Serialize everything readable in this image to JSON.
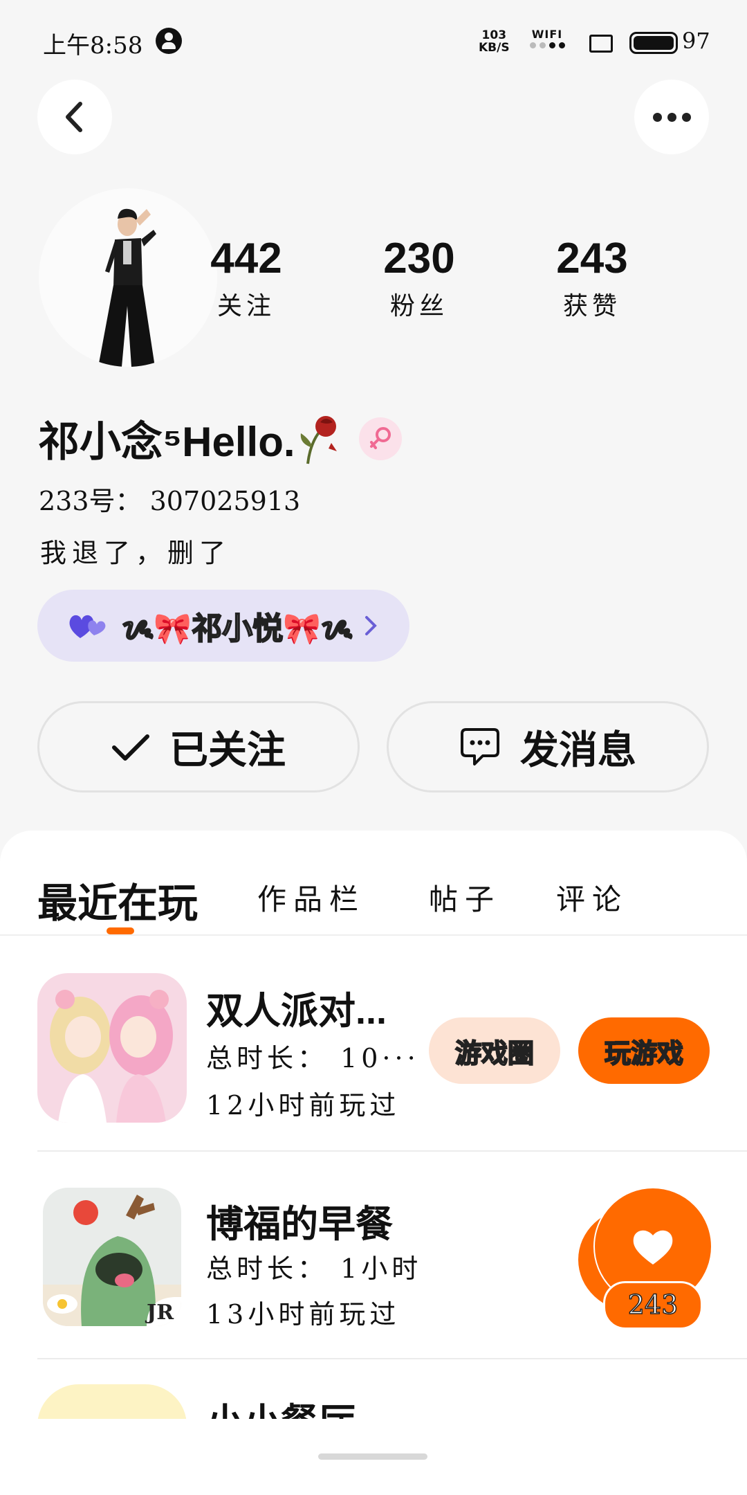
{
  "status_bar": {
    "time": "上午8:58",
    "speed_value": "103",
    "speed_unit": "KB/S",
    "wifi_label": "WIFI",
    "battery": "97"
  },
  "profile": {
    "stats": [
      {
        "value": "442",
        "label": "关注"
      },
      {
        "value": "230",
        "label": "粉丝"
      },
      {
        "value": "243",
        "label": "获赞"
      }
    ],
    "username": "祁小念⁵Hello.",
    "id_line": "233号： 307025913",
    "bio": "我退了，删了",
    "cp_name": "ᝰ🎀祁小悦🎀ᝰ"
  },
  "actions": {
    "follow_label": "已关注",
    "message_label": "发消息"
  },
  "tabs": [
    {
      "label": "最近在玩"
    },
    {
      "label": "作品栏"
    },
    {
      "label": "帖子"
    },
    {
      "label": "评论"
    }
  ],
  "games": [
    {
      "title": "双人派对...",
      "duration": "总时长： 10···",
      "last_played": "12小时前玩过",
      "circle_button": "游戏圈",
      "play_button": "玩游戏"
    },
    {
      "title": "博福的早餐",
      "duration": "总时长： 1小时",
      "last_played": "13小时前玩过",
      "icon_badge": "JR"
    },
    {
      "title": "小小餐厅"
    }
  ],
  "like_fab": {
    "count": "243"
  },
  "colors": {
    "accent": "#ff6a00",
    "pill_bg": "#e6e3f6",
    "light_orange": "#fde3d4"
  }
}
